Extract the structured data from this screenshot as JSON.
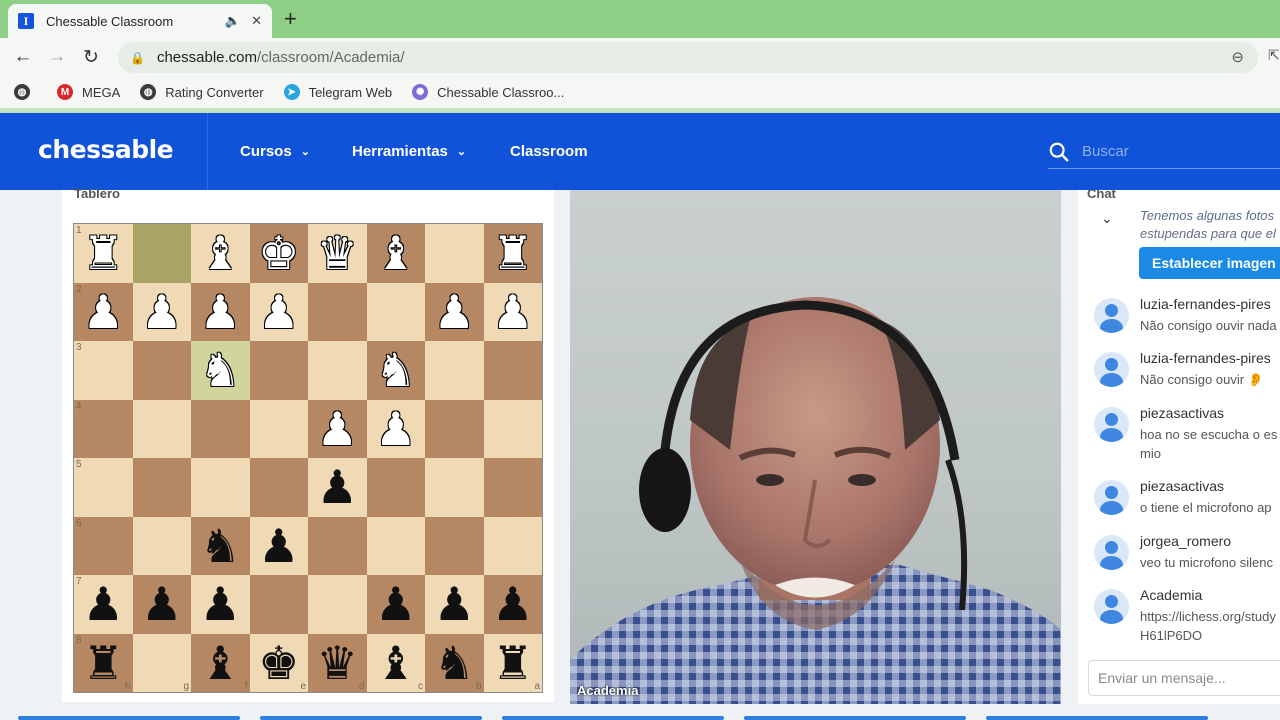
{
  "browser": {
    "tab_title": "Chessable Classroom",
    "tab_favicon": "I",
    "url_domain": "chessable.com",
    "url_path": "/classroom/Academia/",
    "bookmarks": [
      {
        "label": "",
        "icon": "globe-icon"
      },
      {
        "label": "MEGA",
        "icon": "mega-icon"
      },
      {
        "label": "Rating Converter",
        "icon": "globe-icon"
      },
      {
        "label": "Telegram Web",
        "icon": "telegram-icon"
      },
      {
        "label": "Chessable Classroo...",
        "icon": "chessable-icon"
      }
    ]
  },
  "header": {
    "logo": "chessable",
    "nav": [
      {
        "label": "Cursos"
      },
      {
        "label": "Herramientas"
      },
      {
        "label": "Classroom"
      }
    ],
    "search_placeholder": "Buscar"
  },
  "board": {
    "title": "Tablero",
    "rank_labels": [
      "1",
      "2",
      "3",
      "4",
      "5",
      "6",
      "7",
      "8"
    ],
    "file_labels": [
      "h",
      "g",
      "f",
      "e",
      "d",
      "c",
      "b",
      "a"
    ],
    "ranks": [
      [
        "wR",
        "",
        "wB",
        "wK",
        "wQ",
        "wB",
        "",
        "wR"
      ],
      [
        "wP",
        "wP",
        "wP",
        "wP",
        "",
        "",
        "wP",
        "wP"
      ],
      [
        "",
        "",
        "wN",
        "",
        "",
        "wN",
        "",
        ""
      ],
      [
        "",
        "",
        "",
        "",
        "wP",
        "wP",
        "",
        ""
      ],
      [
        "",
        "",
        "",
        "",
        "bP",
        "",
        "",
        ""
      ],
      [
        "",
        "",
        "bN",
        "bP",
        "",
        "",
        "",
        ""
      ],
      [
        "bP",
        "bP",
        "bP",
        "",
        "",
        "bP",
        "bP",
        "bP"
      ],
      [
        "bR",
        "",
        "bB",
        "bK",
        "bQ",
        "bB",
        "bN",
        "bR"
      ]
    ],
    "highlight_squares": [
      [
        0,
        1
      ],
      [
        2,
        2
      ]
    ]
  },
  "video": {
    "label": "Academia"
  },
  "chat": {
    "title": "Chat",
    "notice_line1": "Tenemos algunas fotos",
    "notice_line2": "estupendas para que el",
    "notice_button": "Establecer imagen de",
    "messages": [
      {
        "user": "luzia-fernandes-pires",
        "text": "Não consigo ouvir nada"
      },
      {
        "user": "luzia-fernandes-pires",
        "text": "Não consigo ouvir 👂"
      },
      {
        "user": "piezasactivas",
        "text": "hoa no se escucha o es\nmio"
      },
      {
        "user": "piezasactivas",
        "text": "o tiene el microfono ap"
      },
      {
        "user": "jorgea_romero",
        "text": "veo tu microfono silenc"
      },
      {
        "user": "Academia",
        "text": "https://lichess.org/study\nH61lP6DO"
      }
    ],
    "input_placeholder": "Enviar un mensaje..."
  }
}
